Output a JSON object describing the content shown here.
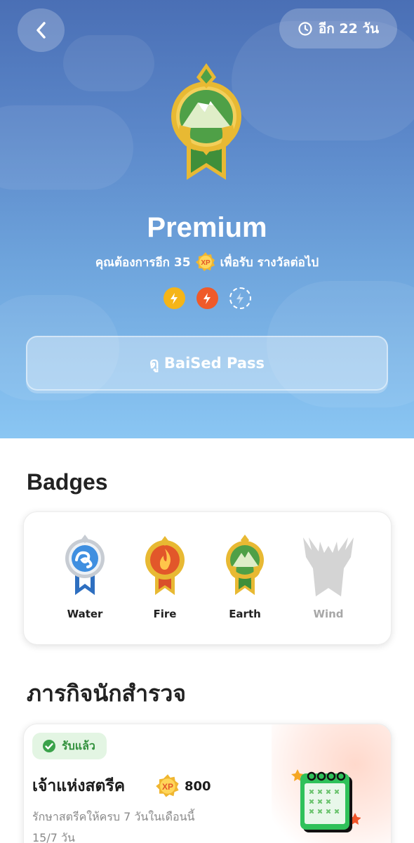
{
  "header": {
    "timer_text": "อีก 22 วัน"
  },
  "hero": {
    "tier_title": "Premium",
    "subtitle_before": "คุณต้องการอีก 35",
    "xp_icon_text": "XP",
    "subtitle_after": "เพื่อรับ รางวัลต่อไป",
    "energy_slots": [
      "filled-yellow",
      "filled-red",
      "empty"
    ],
    "pass_button": "ดู BaiSed Pass"
  },
  "badges": {
    "title": "Badges",
    "items": [
      {
        "label": "Water",
        "unlocked": true,
        "color": "#2e7fd3"
      },
      {
        "label": "Fire",
        "unlocked": true,
        "color": "#e2572a"
      },
      {
        "label": "Earth",
        "unlocked": true,
        "color": "#3b8f3a"
      },
      {
        "label": "Wind",
        "unlocked": false,
        "color": "#d4d4d4"
      }
    ]
  },
  "missions": {
    "title": "ภารกิจนักสำรวจ",
    "items": [
      {
        "status": "รับแล้ว",
        "name": "เจ้าแห่งสตรีค",
        "xp_icon_text": "XP",
        "xp": "800",
        "description": "รักษาสตรีคให้ครบ 7 วันในเดือนนี้",
        "progress": "15/7 วัน"
      }
    ]
  },
  "colors": {
    "hero_top": "#4a6fb5",
    "hero_bottom": "#8ac6f3",
    "gold": "#e8b933",
    "claimed_green": "#2f8f3a"
  }
}
